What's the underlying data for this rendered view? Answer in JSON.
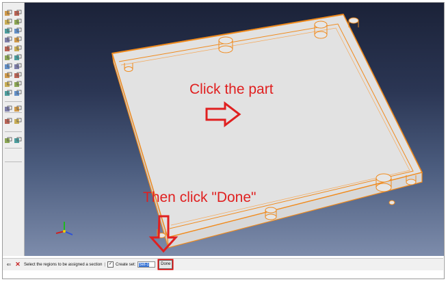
{
  "annotations": {
    "click_part": "Click the part",
    "click_done": "Then click \"Done\""
  },
  "prompt": {
    "message": "Select the regions to be assigned a section",
    "separator": "|",
    "create_set_label": "Create set:",
    "create_set_value": "Set-1",
    "create_set_checked": "✓",
    "done_label": "Done"
  },
  "toolbox": {
    "button_icons": [
      "create-part-icon",
      "part-manager-icon",
      "create-material-icon",
      "material-manager-icon",
      "create-section-icon",
      "section-manager-icon",
      "assign-section-icon",
      "section-assignment-manager-icon",
      "assign-beam-orientation-icon",
      "query-icon",
      "assign-material-orientation-icon",
      "orientation-manager-icon",
      "create-profile-icon",
      "profile-manager-icon",
      "special-icon",
      "inertia-manager-icon",
      "skin-icon",
      "stringer-icon",
      "datum-point-icon",
      "datum-axis-icon",
      "partition-icon",
      "partition-edge-icon",
      "datum-plane-icon",
      "datum-csys-icon",
      "set-create-icon",
      "surface-create-icon"
    ]
  },
  "colors": {
    "part_edge": "#f08a1c",
    "part_face": "#e2e2e2",
    "annotation": "#e02020"
  }
}
